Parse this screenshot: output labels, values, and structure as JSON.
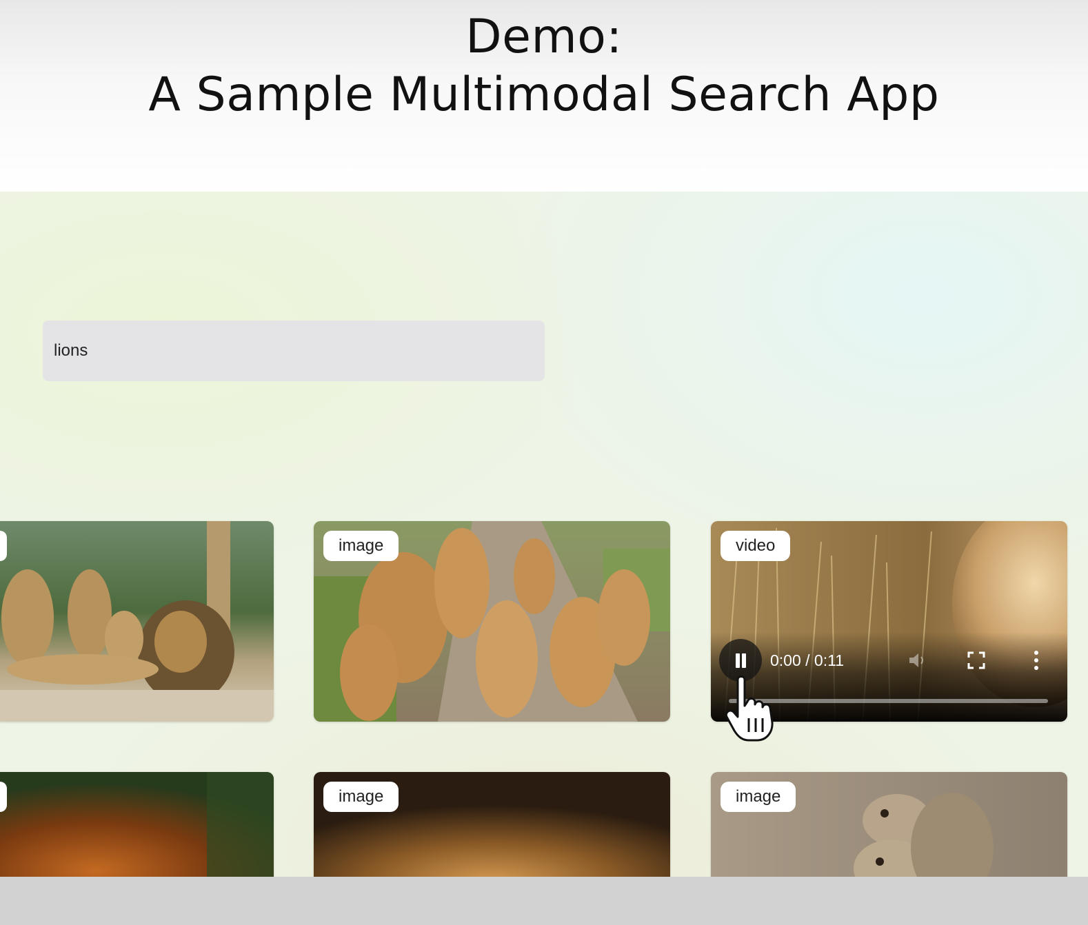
{
  "slide": {
    "title_line1": "Demo:",
    "title_line2": "A Sample Multimodal Search App"
  },
  "search": {
    "value": "lions"
  },
  "results": [
    {
      "type": "image",
      "subject": "lion pride with male lion and cubs resting"
    },
    {
      "type": "image",
      "subject": "lionesses and cubs walking along a dirt path"
    },
    {
      "type": "video",
      "subject": "lion mane in dry grass"
    },
    {
      "type": "image",
      "subject": "male lion head close-up"
    },
    {
      "type": "image",
      "subject": "lion with mane"
    },
    {
      "type": "image",
      "subject": "meerkats huddled together"
    }
  ],
  "video_player": {
    "time": "0:00 / 0:11",
    "progress": 0,
    "state": "playing",
    "icons": [
      "pause-icon",
      "volume-muted-icon",
      "fullscreen-icon",
      "more-options-icon"
    ]
  },
  "cursor": "hand-pointer-icon",
  "colors": {
    "search_background": "#e4e4e7",
    "badge_background": "#ffffff",
    "app_background": "#eef4e6"
  }
}
